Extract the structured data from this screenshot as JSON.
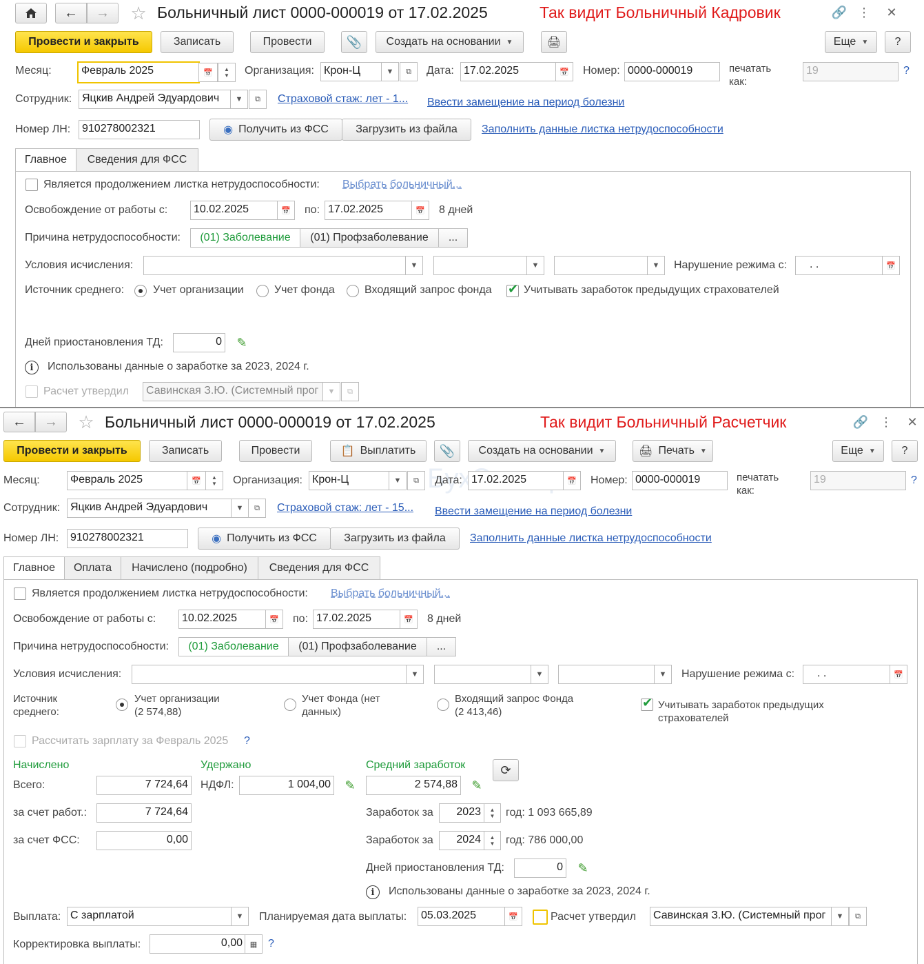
{
  "top": {
    "title": "Больничный лист 0000-000019 от 17.02.2025",
    "annotation": "Так видит Больничный Кадровик",
    "toolbar": {
      "post_close": "Провести и закрыть",
      "save": "Записать",
      "post": "Провести",
      "create_based": "Создать на основании",
      "more": "Еще",
      "help": "?"
    },
    "month_label": "Месяц:",
    "month_value": "Февраль 2025",
    "org_label": "Организация:",
    "org_value": "Крон-Ц",
    "date_label": "Дата:",
    "date_value": "17.02.2025",
    "number_label": "Номер:",
    "number_value": "0000-000019",
    "print_as_label": "печатать как:",
    "print_as_value": "19",
    "employee_label": "Сотрудник:",
    "employee_value": "Яцкив Андрей Эдуардович",
    "insurance_link": "Страховой стаж: лет - 1...",
    "substitute_link": "Ввести замещение на период болезни",
    "ln_label": "Номер ЛН:",
    "ln_value": "910278002321",
    "get_fss": "Получить из ФСС",
    "load_file": "Загрузить из файла",
    "fill_link": "Заполнить данные листка нетрудоспособности",
    "tabs": [
      "Главное",
      "Сведения для ФСС"
    ],
    "continuation_label": "Является продолжением листка нетрудоспособности:",
    "choose_sick": "Выбрать больничный...",
    "release_label": "Освобождение от работы с:",
    "release_from": "10.02.2025",
    "to_label": "по:",
    "release_to": "17.02.2025",
    "days": "8 дней",
    "reason_label": "Причина нетрудоспособности:",
    "reason1": "(01) Заболевание",
    "reason2": "(01) Профзаболевание",
    "reason_more": "...",
    "conditions_label": "Условия исчисления:",
    "violation_label": "Нарушение режима с:",
    "violation_value": ". .",
    "source_label": "Источник среднего:",
    "source_opts": [
      "Учет организации",
      "Учет фонда",
      "Входящий запрос фонда"
    ],
    "prev_insurers": "Учитывать заработок предыдущих страхователей",
    "suspension_label": "Дней приостановления ТД:",
    "suspension_value": "0",
    "earnings_info": "Использованы данные о заработке за  2023,  2024 г.",
    "approved_label": "Расчет утвердил",
    "approved_value": "Савинская З.Ю. (Системный прог"
  },
  "bottom": {
    "title": "Больничный лист 0000-000019 от 17.02.2025",
    "annotation": "Так видит Больничный Расчетчик",
    "toolbar": {
      "post_close": "Провести и закрыть",
      "save": "Записать",
      "post": "Провести",
      "pay": "Выплатить",
      "create_based": "Создать на основании",
      "print": "Печать",
      "more": "Еще",
      "help": "?"
    },
    "watermark": "БухЭксперт",
    "month_label": "Месяц:",
    "month_value": "Февраль 2025",
    "org_label": "Организация:",
    "org_value": "Крон-Ц",
    "date_label": "Дата:",
    "date_value": "17.02.2025",
    "number_label": "Номер:",
    "number_value": "0000-000019",
    "print_as_label": "печатать как:",
    "print_as_value": "19",
    "employee_label": "Сотрудник:",
    "employee_value": "Яцкив Андрей Эдуардович",
    "insurance_link": "Страховой стаж: лет - 15...",
    "substitute_link": "Ввести замещение на период болезни",
    "ln_label": "Номер ЛН:",
    "ln_value": "910278002321",
    "get_fss": "Получить из ФСС",
    "load_file": "Загрузить из файла",
    "fill_link": "Заполнить данные листка нетрудоспособности",
    "tabs": [
      "Главное",
      "Оплата",
      "Начислено (подробно)",
      "Сведения для ФСС"
    ],
    "continuation_label": "Является продолжением листка нетрудоспособности:",
    "choose_sick": "Выбрать больничный...",
    "release_label": "Освобождение от работы с:",
    "release_from": "10.02.2025",
    "to_label": "по:",
    "release_to": "17.02.2025",
    "days": "8 дней",
    "reason_label": "Причина нетрудоспособности:",
    "reason1": "(01) Заболевание",
    "reason2": "(01) Профзаболевание",
    "reason_more": "...",
    "conditions_label": "Условия исчисления:",
    "violation_label": "Нарушение режима с:",
    "violation_value": ". .",
    "source_label_1": "Источник",
    "source_label_2": "среднего:",
    "src_org_1": "Учет организации",
    "src_org_2": "(2 574,88)",
    "src_fund_1": "Учет Фонда (нет",
    "src_fund_2": "данных)",
    "src_req_1": "Входящий запрос Фонда",
    "src_req_2": "(2 413,46)",
    "prev_1": "Учитывать заработок предыдущих",
    "prev_2": "страхователей",
    "calc_salary": "Рассчитать зарплату за Февраль 2025",
    "accrued_head": "Начислено",
    "withheld_head": "Удержано",
    "avg_head": "Средний заработок",
    "total_label": "Всего:",
    "total_value": "7 724,64",
    "ndfl_label": "НДФЛ:",
    "ndfl_value": "1 004,00",
    "avg_value": "2 574,88",
    "employer_label": "за счет работ.:",
    "employer_value": "7 724,64",
    "fss_label": "за счет ФСС:",
    "fss_value": "0,00",
    "earn1_label": "Заработок за",
    "earn1_year": "2023",
    "earn1_text": "год: 1 093 665,89",
    "earn2_label": "Заработок за",
    "earn2_year": "2024",
    "earn2_text": "год: 786 000,00",
    "suspension_label": "Дней приостановления ТД:",
    "suspension_value": "0",
    "earnings_info": "Использованы данные о заработке за  2023,  2024 г.",
    "payout_label": "Выплата:",
    "payout_value": "С зарплатой",
    "plan_date_label": "Планируемая дата выплаты:",
    "plan_date_value": "05.03.2025",
    "approved_label": "Расчет утвердил",
    "approved_value": "Савинская З.Ю. (Системный прог",
    "correction_label": "Корректировка выплаты:",
    "correction_value": "0,00"
  }
}
